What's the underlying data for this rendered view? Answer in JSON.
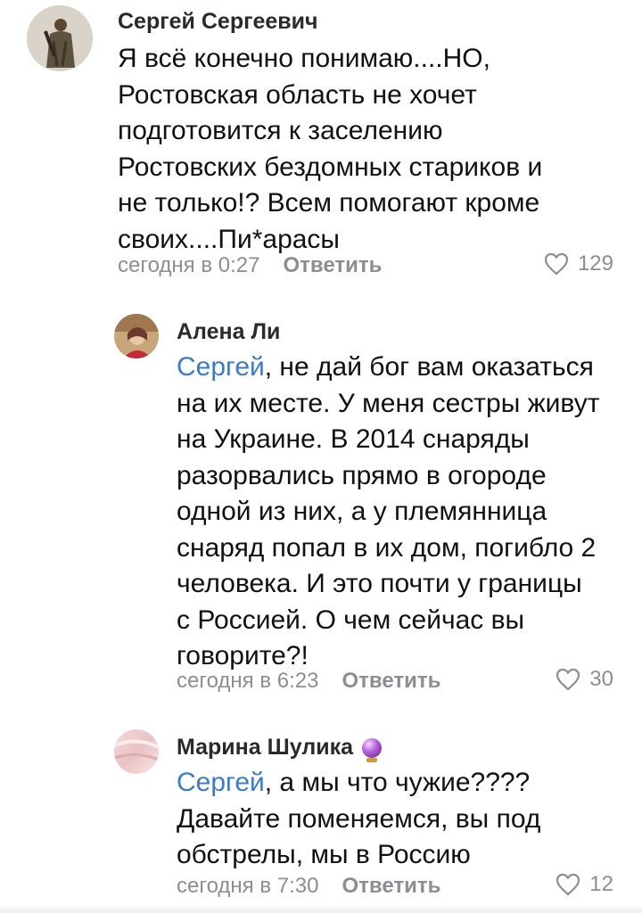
{
  "comments": [
    {
      "author": "Сергей Сергеевич",
      "lines": [
        "Я всё конечно понимаю....НО,",
        "Ростовская область не хочет",
        "подготовится к заселению",
        "Ростовских бездомных стариков и",
        "не только!? Всем помогают кроме",
        "своих....Пи*арасы"
      ],
      "time": "сегодня в 0:27",
      "reply_label": "Ответить",
      "likes": "129",
      "avatar_icon": "avatar-photo-soldier"
    },
    {
      "author": "Алена Ли",
      "mention": "Сергей",
      "first_line_rest": ", не дай бог вам оказаться",
      "lines": [
        "на их месте. У меня сестры живут",
        "на Украине. В 2014 снаряды",
        "разорвались прямо в огороде",
        "одной из них, а у племянница",
        "снаряд попал в их дом, погибло 2",
        "человека. И это почти у границы",
        "с Россией. О чем сейчас вы",
        "говорите?!"
      ],
      "time": "сегодня в 6:23",
      "reply_label": "Ответить",
      "likes": "30",
      "avatar_icon": "avatar-photo-woman"
    },
    {
      "author": "Марина Шулика",
      "author_icon": "crystal-ball-icon",
      "mention": "Сергей",
      "first_line_rest": ", а мы что чужие????",
      "lines": [
        "Давайте поменяемся, вы под",
        "обстрелы, мы в Россию"
      ],
      "time": "сегодня в 7:30",
      "reply_label": "Ответить",
      "likes": "12",
      "avatar_icon": "avatar-photo-pink"
    }
  ],
  "colors": {
    "mention": "#3b7cc7",
    "meta": "#8b8e93",
    "text": "#111111"
  }
}
